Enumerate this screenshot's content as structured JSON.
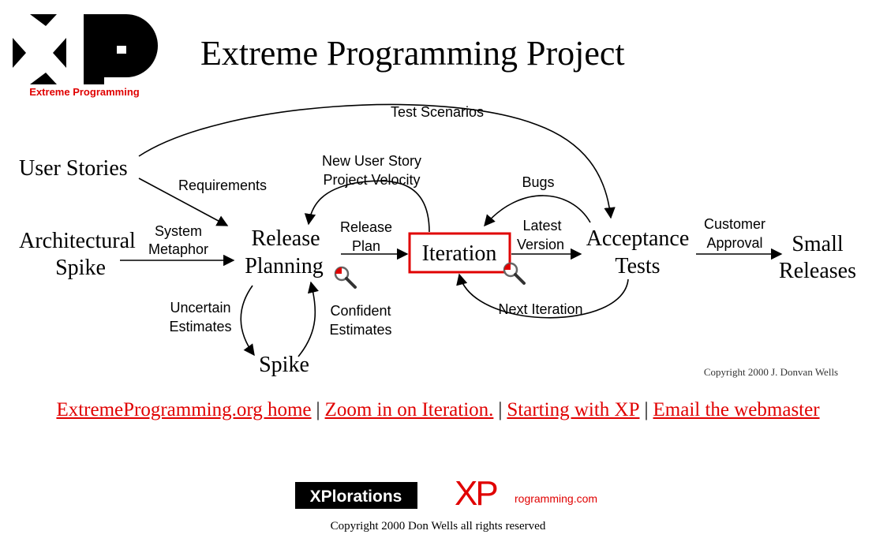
{
  "logo": {
    "text": "Extreme Programming"
  },
  "title": "Extreme Programming Project",
  "diagram": {
    "nodes": {
      "user_stories": "User Stories",
      "architectural_spike": [
        "Architectural",
        "Spike"
      ],
      "release_planning": [
        "Release",
        "Planning"
      ],
      "iteration": "Iteration",
      "acceptance_tests": [
        "Acceptance",
        "Tests"
      ],
      "small_releases": [
        "Small",
        "Releases"
      ],
      "spike": "Spike"
    },
    "edges": {
      "test_scenarios": "Test Scenarios",
      "requirements": "Requirements",
      "system_metaphor": [
        "System",
        "Metaphor"
      ],
      "new_user_story": [
        "New User Story",
        "Project Velocity"
      ],
      "release_plan": [
        "Release",
        "Plan"
      ],
      "bugs": "Bugs",
      "latest_version": [
        "Latest",
        "Version"
      ],
      "customer_approval": [
        "Customer",
        "Approval"
      ],
      "uncertain_estimates": [
        "Uncertain",
        "Estimates"
      ],
      "confident_estimates": [
        "Confident",
        "Estimates"
      ],
      "next_iteration": "Next Iteration"
    },
    "copyright": "Copyright 2000 J. Donvan Wells"
  },
  "nav": {
    "links": [
      "ExtremeProgramming.org home",
      "Zoom in on Iteration.",
      "Starting with XP",
      "Email the webmaster"
    ],
    "separator": "|"
  },
  "footer": {
    "xplorations": "XPlorations",
    "xprogramming_xp": "XP",
    "xprogramming_rest": "rogramming.com",
    "copyright": "Copyright 2000 Don Wells all rights reserved"
  },
  "colors": {
    "link": "#e00000",
    "iteration_box": "#e00000",
    "logo_text": "#e00000"
  },
  "icons": [
    "zoom-magnifier-icon"
  ]
}
